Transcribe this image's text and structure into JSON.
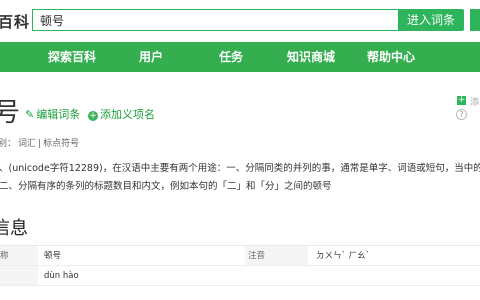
{
  "header": {
    "logo_text": "百科",
    "search_value": "顿号",
    "enter_button": "进入词条"
  },
  "nav": {
    "items": [
      "探索百科",
      "用户",
      "任务",
      "知识商城",
      "帮助中心"
    ]
  },
  "entry": {
    "title": "号",
    "edit_label": "编辑词条",
    "add_label": "添加义项名",
    "side_add": "添",
    "categories_prefix": "别：",
    "categories": [
      "词汇",
      "标点符号"
    ]
  },
  "body": {
    "line1": "、(unicode字符12289)，在汉语中主要有两个用途：一、分隔同类的并列的事，通常是单字、词语或短句，当中的停",
    "line2": "二、分隔有序的条列的标题数目和内文，例如本句的「二」和「分」之间的顿号"
  },
  "info": {
    "section_title": "信息",
    "row1": {
      "label1": "称",
      "value1_label": "顿号",
      "label2": "注音",
      "value2": "ㄉㄨㄣˋ ㄏㄠˋ"
    },
    "row2": {
      "value": "dùn hào"
    }
  }
}
